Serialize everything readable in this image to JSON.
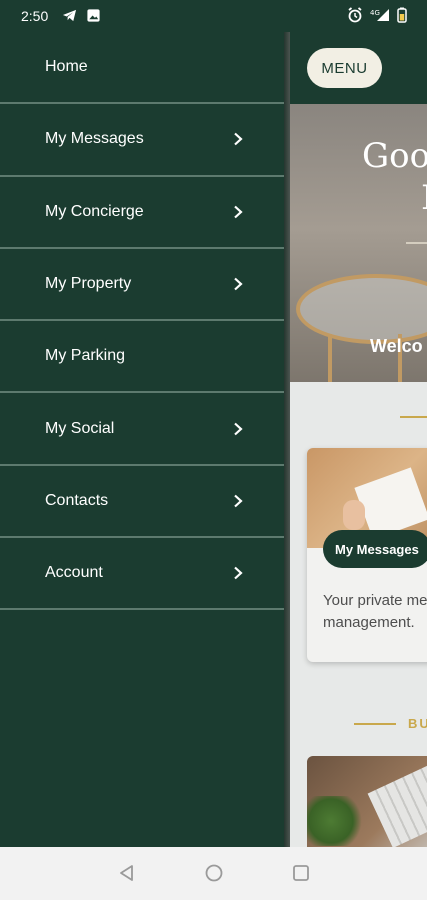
{
  "status_bar": {
    "time": "2:50",
    "left_icons": [
      "telegram-icon",
      "image-icon"
    ],
    "right_icons": [
      "alarm-icon",
      "signal-icon",
      "battery-icon"
    ],
    "signal_badge": "4G"
  },
  "drawer": {
    "items": [
      {
        "label": "Home",
        "has_chevron": false
      },
      {
        "label": "My Messages",
        "has_chevron": true
      },
      {
        "label": "My Concierge",
        "has_chevron": true
      },
      {
        "label": "My Property",
        "has_chevron": true
      },
      {
        "label": "My Parking",
        "has_chevron": false
      },
      {
        "label": "My Social",
        "has_chevron": true
      },
      {
        "label": "Contacts",
        "has_chevron": true
      },
      {
        "label": "Account",
        "has_chevron": true
      }
    ]
  },
  "app": {
    "menu_button": "MENU",
    "hero": {
      "greeting_line1": "Goo",
      "greeting_line2": "I",
      "welcome": "Welco"
    },
    "card1": {
      "badge": "My Messages",
      "text": "Your private me management."
    },
    "section2_label": "BU"
  },
  "nav_bar": {
    "buttons": [
      "back-icon",
      "home-icon",
      "recents-icon"
    ]
  },
  "colors": {
    "primary": "#1b3c30",
    "accent_gold": "#c9a84c",
    "divider": "#5d7a6e",
    "nav_bg": "#f2f2f2"
  }
}
